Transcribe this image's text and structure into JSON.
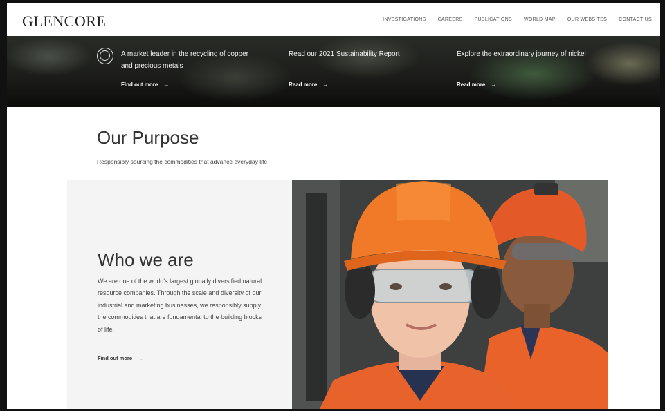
{
  "header": {
    "logo": "GLENCORE",
    "nav": [
      "INVESTIGATIONS",
      "CAREERS",
      "PUBLICATIONS",
      "WORLD MAP",
      "OUR WEBSITES",
      "CONTACT US"
    ]
  },
  "hero": {
    "items": [
      {
        "text": "A market leader in the recycling of copper and precious metals",
        "link": "Find out more",
        "arrow": "→"
      },
      {
        "text": "Read our 2021 Sustainability Report",
        "link": "Read more",
        "arrow": "→"
      },
      {
        "text": "Explore the extraordinary journey of nickel",
        "link": "Read more",
        "arrow": "→"
      }
    ]
  },
  "purpose": {
    "title": "Our Purpose",
    "subtitle": "Responsibly sourcing the commodities that advance everyday life"
  },
  "who": {
    "title": "Who we are",
    "body": "We are one of the world's largest globally diversified natural resource companies. Through the scale and diversity of our industrial and marketing businesses, we responsibly supply the commodities that are fundamental to the building blocks of life.",
    "link": "Find out more",
    "arrow": "→"
  }
}
